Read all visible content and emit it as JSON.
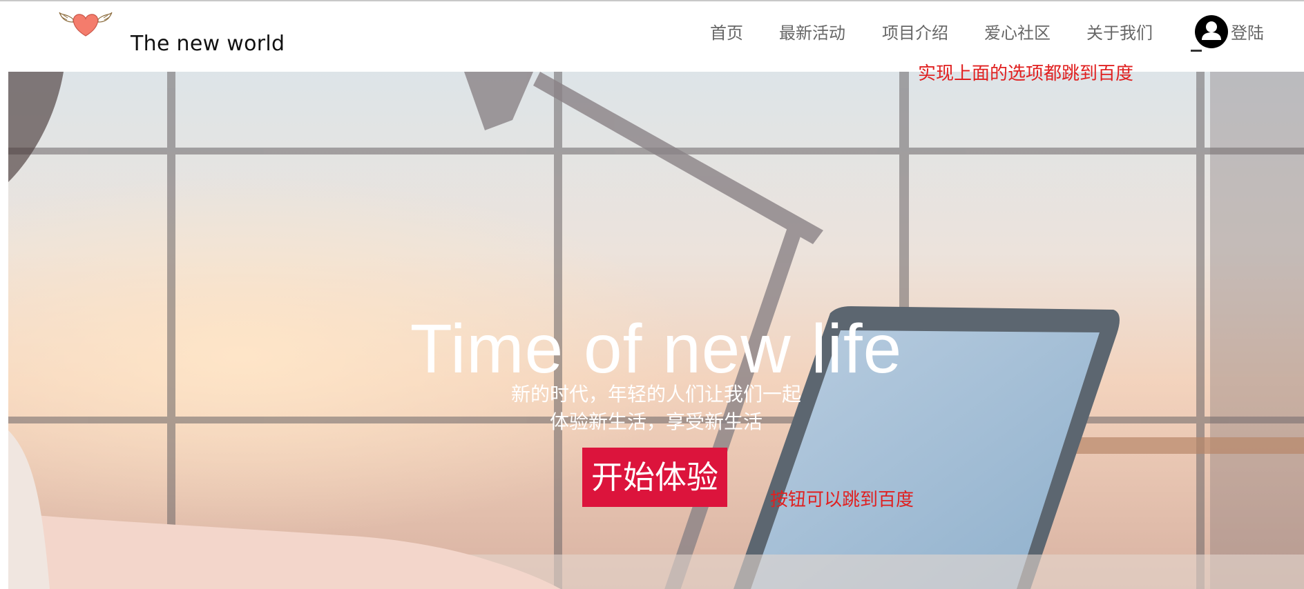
{
  "header": {
    "brand": "The new world",
    "nav": [
      {
        "label": "首页"
      },
      {
        "label": "最新活动"
      },
      {
        "label": "项目介绍"
      },
      {
        "label": "爱心社区"
      },
      {
        "label": "关于我们"
      }
    ],
    "login_label": "登陆",
    "logo_icon": "winged-heart-icon",
    "login_icon": "user-avatar-icon"
  },
  "hero": {
    "title": "Time of new life",
    "subtitle_line1": "新的时代，年轻的人们让我们一起",
    "subtitle_line2": "体验新生活，享受新生活",
    "cta_label": "开始体验",
    "cta_color": "#dc143c"
  },
  "annotations": {
    "nav_note": "实现上面的选项都跳到百度",
    "button_note": "按钮可以跳到百度",
    "color": "#e02020"
  }
}
